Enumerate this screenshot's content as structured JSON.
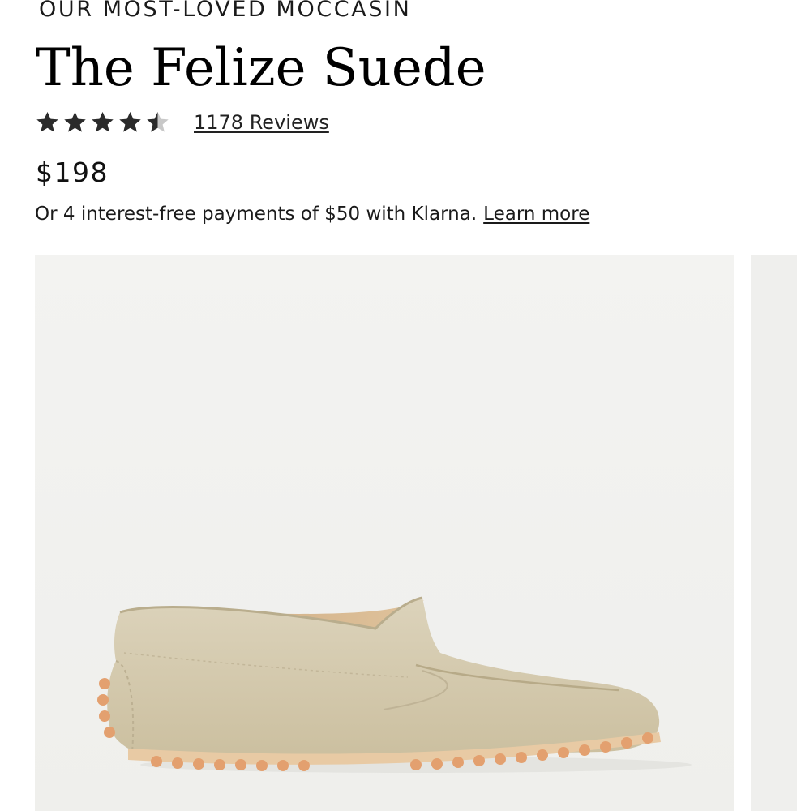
{
  "product": {
    "eyebrow": "OUR MOST-LOVED MOCCASIN",
    "title": "The Felize Suede",
    "rating": {
      "stars": 4.5,
      "max_stars": 5,
      "reviews_label": "1178 Reviews"
    },
    "price": "$198",
    "klarna": {
      "text": "Or 4 interest-free payments of $50 with Klarna.",
      "link_label": "Learn more"
    }
  },
  "gallery": {
    "current_image_icon": "suede-moccasin-photo",
    "background": "#f2f2f0",
    "next_image_peek": true
  },
  "colors": {
    "star": "#2b2b2b",
    "star_empty": "#c8c8c8",
    "suede": "#d4c9ad",
    "sole": "#e2a477"
  }
}
